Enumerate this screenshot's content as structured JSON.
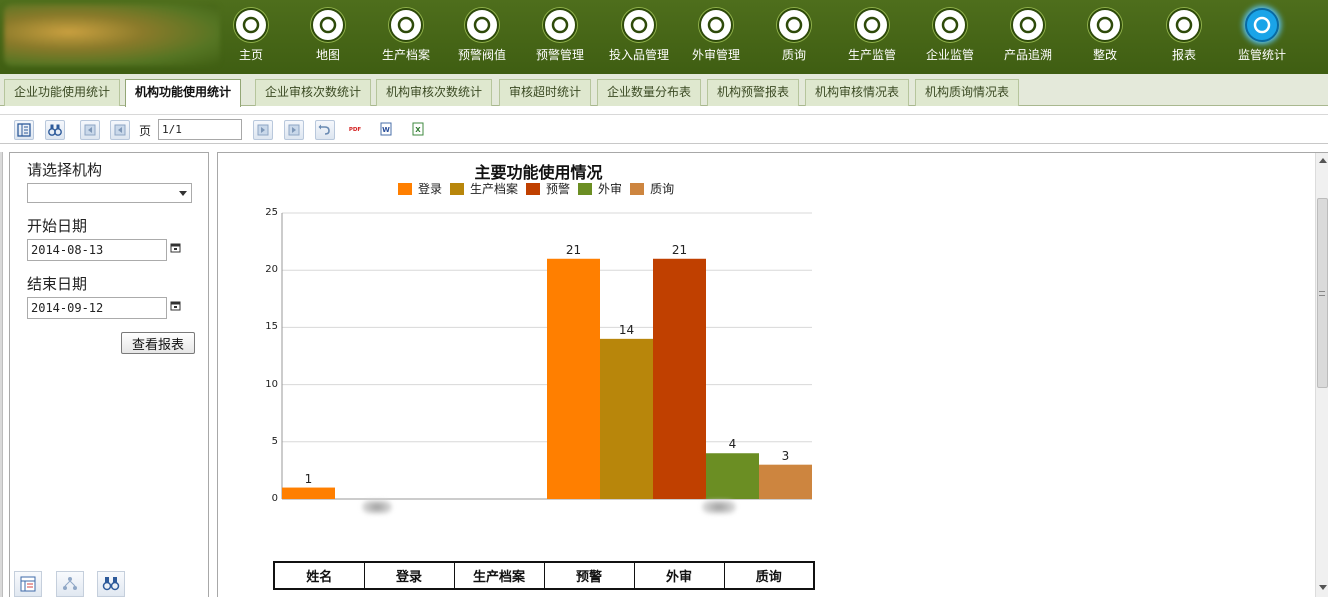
{
  "header": {
    "logo_text": "",
    "nav": [
      {
        "label": "主页",
        "icon": "home-icon"
      },
      {
        "label": "地图",
        "icon": "globe-icon"
      },
      {
        "label": "生产档案",
        "icon": "tractor-icon"
      },
      {
        "label": "预警阀值",
        "icon": "alert-gear-icon"
      },
      {
        "label": "预警管理",
        "icon": "exclamation-icon"
      },
      {
        "label": "投入品管理",
        "icon": "scale-icon"
      },
      {
        "label": "外审管理",
        "icon": "check-gear-icon"
      },
      {
        "label": "质询",
        "icon": "question-icon"
      },
      {
        "label": "生产监管",
        "icon": "users-icon"
      },
      {
        "label": "企业监管",
        "icon": "user-check-icon"
      },
      {
        "label": "产品追溯",
        "icon": "clock-icon"
      },
      {
        "label": "整改",
        "icon": "wand-icon"
      },
      {
        "label": "报表",
        "icon": "bar-chart-icon"
      },
      {
        "label": "监管统计",
        "icon": "truck-icon",
        "active": true
      }
    ]
  },
  "tabs": [
    {
      "label": "企业功能使用统计"
    },
    {
      "label": "机构功能使用统计",
      "active": true
    },
    {
      "label": "企业审核次数统计"
    },
    {
      "label": "机构审核次数统计"
    },
    {
      "label": "审核超时统计"
    },
    {
      "label": "企业数量分布表"
    },
    {
      "label": "机构预警报表"
    },
    {
      "label": "机构审核情况表"
    },
    {
      "label": "机构质询情况表"
    }
  ],
  "toolbar": {
    "page_label": "页",
    "page_value": "1/1",
    "buttons": [
      "toggle-params-icon",
      "search-binoculars-icon",
      "first-page-icon",
      "prev-page-icon",
      "next-page-icon",
      "last-page-icon",
      "refresh-icon",
      "export-pdf-icon",
      "export-word-icon",
      "export-excel-icon"
    ]
  },
  "form": {
    "org_label": "请选择机构",
    "org_value": "",
    "start_label": "开始日期",
    "start_value": "2014-08-13",
    "end_label": "结束日期",
    "end_value": "2014-09-12",
    "submit_label": "查看报表",
    "bottom_buttons": [
      "table-view-icon",
      "tree-view-icon",
      "binoculars-icon"
    ]
  },
  "chart_data": {
    "type": "bar",
    "title": "主要功能使用情况",
    "xlabel": "",
    "ylabel": "",
    "ylim": [
      0,
      25
    ],
    "yticks": [
      0,
      5,
      10,
      15,
      20,
      25
    ],
    "grid": true,
    "legend_position": "top",
    "colors": [
      "#ff7f00",
      "#b8860b",
      "#c04000",
      "#6b8e23",
      "#cd853f"
    ],
    "categories": [
      "",
      ""
    ],
    "series": [
      {
        "name": "登录",
        "values": [
          1,
          21
        ]
      },
      {
        "name": "生产档案",
        "values": [
          0,
          14
        ]
      },
      {
        "name": "预警",
        "values": [
          0,
          21
        ]
      },
      {
        "name": "外审",
        "values": [
          0,
          4
        ]
      },
      {
        "name": "质询",
        "values": [
          0,
          3
        ]
      }
    ]
  },
  "table": {
    "headers": [
      "姓名",
      "登录",
      "生产档案",
      "预警",
      "外审",
      "质询"
    ]
  }
}
